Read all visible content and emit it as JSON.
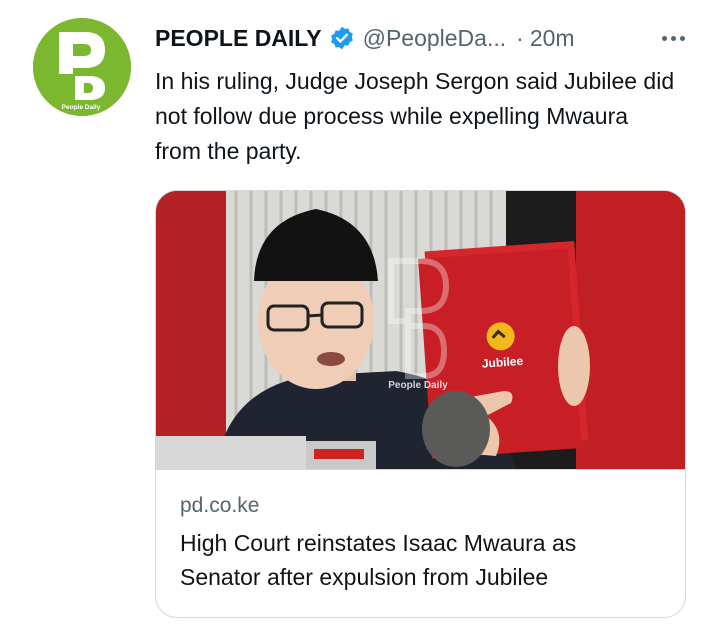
{
  "tweet": {
    "display_name": "PEOPLE DAILY",
    "verified_icon": "verified-badge-icon",
    "handle": "@PeopleDa...",
    "separator": "·",
    "time": "20m",
    "more_icon": "more-horizontal-icon",
    "text": "In his ruling, Judge Joseph Sergon said Jubilee did not follow due process while expelling Mwaura from the party.",
    "avatar_logo_text": "People Daily"
  },
  "card": {
    "domain": "pd.co.ke",
    "title": "High Court reinstates Isaac Mwaura as Senator after expulsion from Jubilee",
    "image_watermark": "People Daily",
    "folder_label": "Jubilee"
  },
  "colors": {
    "avatar_bg": "#7cb82f",
    "verified": "#1d9bf0",
    "secondary_text": "#536471",
    "border": "#cfd9de",
    "folder_red": "#d5262b"
  }
}
